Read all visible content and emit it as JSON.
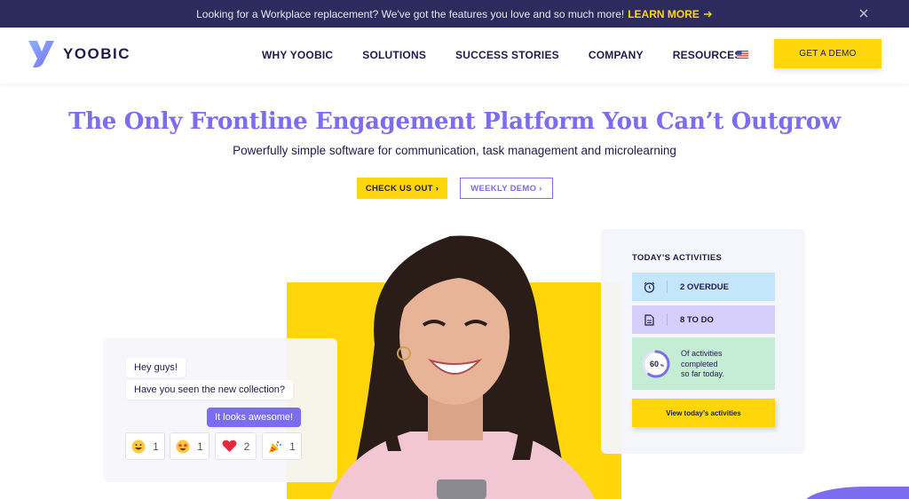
{
  "announcement": {
    "text": "Looking for a Workplace replacement? We've got the features you love and so much more!",
    "link_label": "LEARN MORE"
  },
  "header": {
    "logo_text": "YOOBIC",
    "nav": [
      "WHY YOOBIC",
      "SOLUTIONS",
      "SUCCESS STORIES",
      "COMPANY",
      "RESOURCES"
    ],
    "demo_button": "GET A DEMO"
  },
  "hero": {
    "title": "The Only Frontline Engagement Platform You Can’t Outgrow",
    "subtitle": "Powerfully simple software for communication, task management and microlearning",
    "cta_primary": "CHECK US OUT ›",
    "cta_secondary": "WEEKLY DEMO ›"
  },
  "chat": {
    "messages": [
      {
        "text": "Hey guys!",
        "from": "other"
      },
      {
        "text": "Have you seen the new collection?",
        "from": "other"
      },
      {
        "text": "It looks awesome!",
        "from": "me"
      }
    ],
    "reactions": [
      {
        "icon": "grinning-face-icon",
        "count": "1"
      },
      {
        "icon": "star-struck-face-icon",
        "count": "1"
      },
      {
        "icon": "heart-icon",
        "count": "2"
      },
      {
        "icon": "party-popper-icon",
        "count": "1"
      }
    ]
  },
  "activities": {
    "title": "TODAY’S ACTIVITIES",
    "overdue": "2 OVERDUE",
    "todo": "8 TO DO",
    "progress_percent": "60",
    "progress_unit": "%",
    "progress_text": "Of activities completed so far today.",
    "progress_line1": "Of activities",
    "progress_line2": "completed",
    "progress_line3": "so far today.",
    "view_button": "View today’s activities"
  },
  "colors": {
    "brand_purple": "#7b6cf0",
    "brand_yellow": "#ffd60a",
    "navy": "#1e1b4b",
    "announcement_bg": "#2d2a5e"
  }
}
